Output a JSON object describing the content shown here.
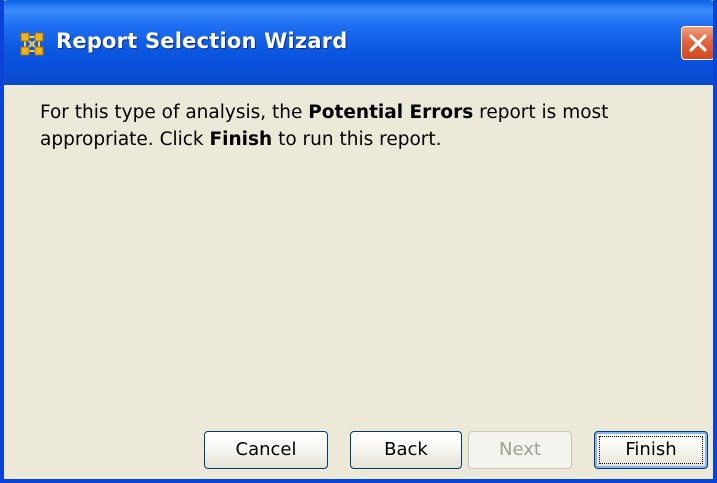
{
  "window": {
    "title": "Report Selection Wizard",
    "app_icon": "network-nodes-icon",
    "close_icon": "close-icon"
  },
  "message": {
    "part1": "For this type of analysis, the ",
    "report_name": "Potential Errors",
    "part2": " report is most appropriate. Click ",
    "action_name": "Finish",
    "part3": " to run this report."
  },
  "buttons": {
    "cancel": "Cancel",
    "back": "Back",
    "next": "Next",
    "finish": "Finish"
  },
  "colors": {
    "titlebar": "#0a4fd8",
    "dialog_background": "#ece9d8",
    "close_button": "#e3643c",
    "app_icon": "#e8b81a",
    "disabled_text": "#a19f94"
  }
}
